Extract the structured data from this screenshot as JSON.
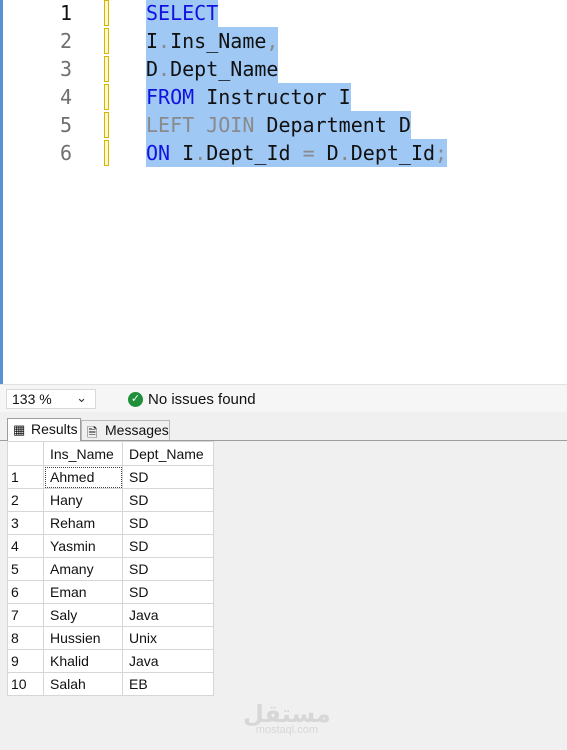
{
  "editor": {
    "line_numbers": [
      "1",
      "2",
      "3",
      "4",
      "5",
      "6"
    ],
    "lines": [
      [
        {
          "t": "SELECT",
          "c": "kw"
        }
      ],
      [
        {
          "t": "I",
          "c": "ty"
        },
        {
          "t": ".",
          "c": "op"
        },
        {
          "t": "Ins_Name",
          "c": "ty"
        },
        {
          "t": ",",
          "c": "op"
        }
      ],
      [
        {
          "t": "D",
          "c": "ty"
        },
        {
          "t": ".",
          "c": "op"
        },
        {
          "t": "Dept_Name",
          "c": "ty"
        }
      ],
      [
        {
          "t": "FROM",
          "c": "kw"
        },
        {
          "t": " Instructor I",
          "c": "ty"
        }
      ],
      [
        {
          "t": "LEFT JOIN",
          "c": "gr"
        },
        {
          "t": " Department D",
          "c": "ty"
        }
      ],
      [
        {
          "t": "ON",
          "c": "kw"
        },
        {
          "t": " I",
          "c": "ty"
        },
        {
          "t": ".",
          "c": "op"
        },
        {
          "t": "Dept_Id ",
          "c": "ty"
        },
        {
          "t": "=",
          "c": "op"
        },
        {
          "t": " D",
          "c": "ty"
        },
        {
          "t": ".",
          "c": "op"
        },
        {
          "t": "Dept_Id",
          "c": "ty"
        },
        {
          "t": ";",
          "c": "op"
        }
      ]
    ],
    "colors": {
      "keyword": "#1212e0",
      "text": "#111111",
      "gray": "#8a8a8a",
      "selection": "#9fc8f5"
    }
  },
  "status": {
    "zoom": "133 %",
    "zoom_icon": "chevron-down-icon",
    "issues_icon": "check-circle-icon",
    "issues_text": "No issues found",
    "issues_color": "#1f8f3a"
  },
  "tabs": {
    "results": "Results",
    "messages": "Messages"
  },
  "grid": {
    "columns": [
      "Ins_Name",
      "Dept_Name"
    ],
    "rows": [
      [
        "1",
        "Ahmed",
        "SD"
      ],
      [
        "2",
        "Hany",
        "SD"
      ],
      [
        "3",
        "Reham",
        "SD"
      ],
      [
        "4",
        "Yasmin",
        "SD"
      ],
      [
        "5",
        "Amany",
        "SD"
      ],
      [
        "6",
        "Eman",
        "SD"
      ],
      [
        "7",
        "Saly",
        "Java"
      ],
      [
        "8",
        "Hussien",
        "Unix"
      ],
      [
        "9",
        "Khalid",
        "Java"
      ],
      [
        "10",
        "Salah",
        "EB"
      ]
    ]
  },
  "watermark": {
    "logo": "مستقل",
    "text": "mostaql.com"
  }
}
